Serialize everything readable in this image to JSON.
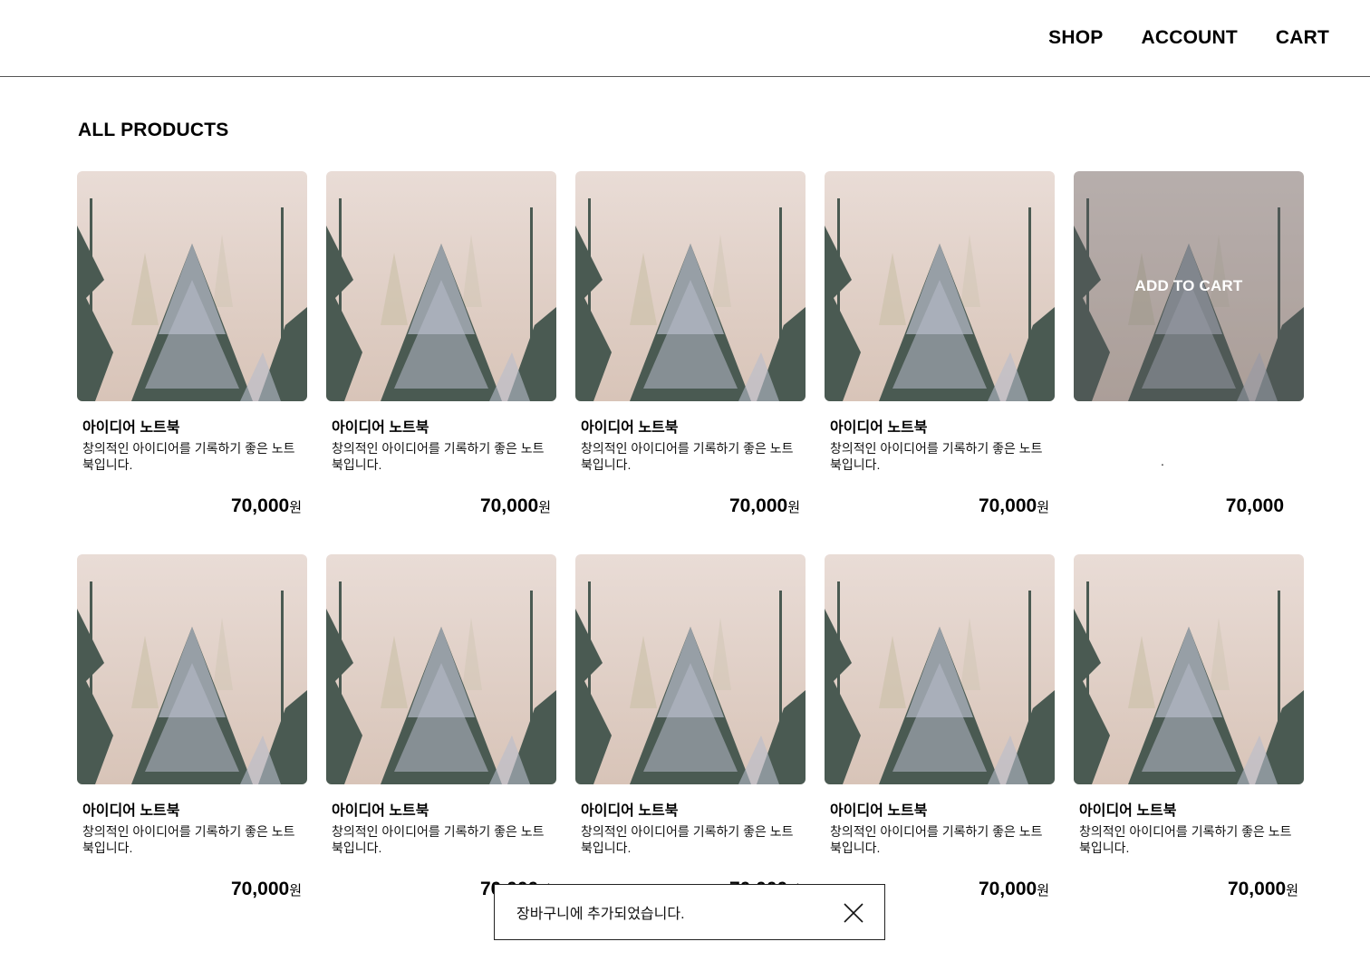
{
  "nav": {
    "shop": "SHOP",
    "account": "ACCOUNT",
    "cart": "CART"
  },
  "page_title": "ALL PRODUCTS",
  "overlay_label": "ADD TO CART",
  "products": [
    {
      "name": "아이디어 노트북",
      "desc": "창의적인 아이디어를 기록하기 좋은 노트북입니다.",
      "price": "70,000",
      "unit": "원"
    },
    {
      "name": "아이디어 노트북",
      "desc": "창의적인 아이디어를 기록하기 좋은 노트북입니다.",
      "price": "70,000",
      "unit": "원"
    },
    {
      "name": "아이디어 노트북",
      "desc": "창의적인 아이디어를 기록하기 좋은 노트북입니다.",
      "price": "70,000",
      "unit": "원"
    },
    {
      "name": "아이디어 노트북",
      "desc": "창의적인 아이디어를 기록하기 좋은 노트북입니다.",
      "price": "70,000",
      "unit": "원"
    },
    {
      "name": "",
      "desc": ".",
      "price": "70,000",
      "unit": "",
      "hovered": true
    },
    {
      "name": "아이디어 노트북",
      "desc": "창의적인 아이디어를 기록하기 좋은 노트북입니다.",
      "price": "70,000",
      "unit": "원"
    },
    {
      "name": "아이디어 노트북",
      "desc": "창의적인 아이디어를 기록하기 좋은 노트북입니다.",
      "price": "70,000",
      "unit": "원"
    },
    {
      "name": "아이디어 노트북",
      "desc": "창의적인 아이디어를 기록하기 좋은 노트북입니다.",
      "price": "70,000",
      "unit": "원"
    },
    {
      "name": "아이디어 노트북",
      "desc": "창의적인 아이디어를 기록하기 좋은 노트북입니다.",
      "price": "70,000",
      "unit": "원"
    },
    {
      "name": "아이디어 노트북",
      "desc": "창의적인 아이디어를 기록하기 좋은 노트북입니다.",
      "price": "70,000",
      "unit": "원"
    }
  ],
  "toast": {
    "message": "장바구니에 추가되었습니다.",
    "close_icon": "close-icon"
  },
  "colors": {
    "sky_top": "#e9dcd6",
    "sky_bottom": "#d8c4b8",
    "tree": "#4a5a52",
    "snow": "#b8bccb"
  }
}
